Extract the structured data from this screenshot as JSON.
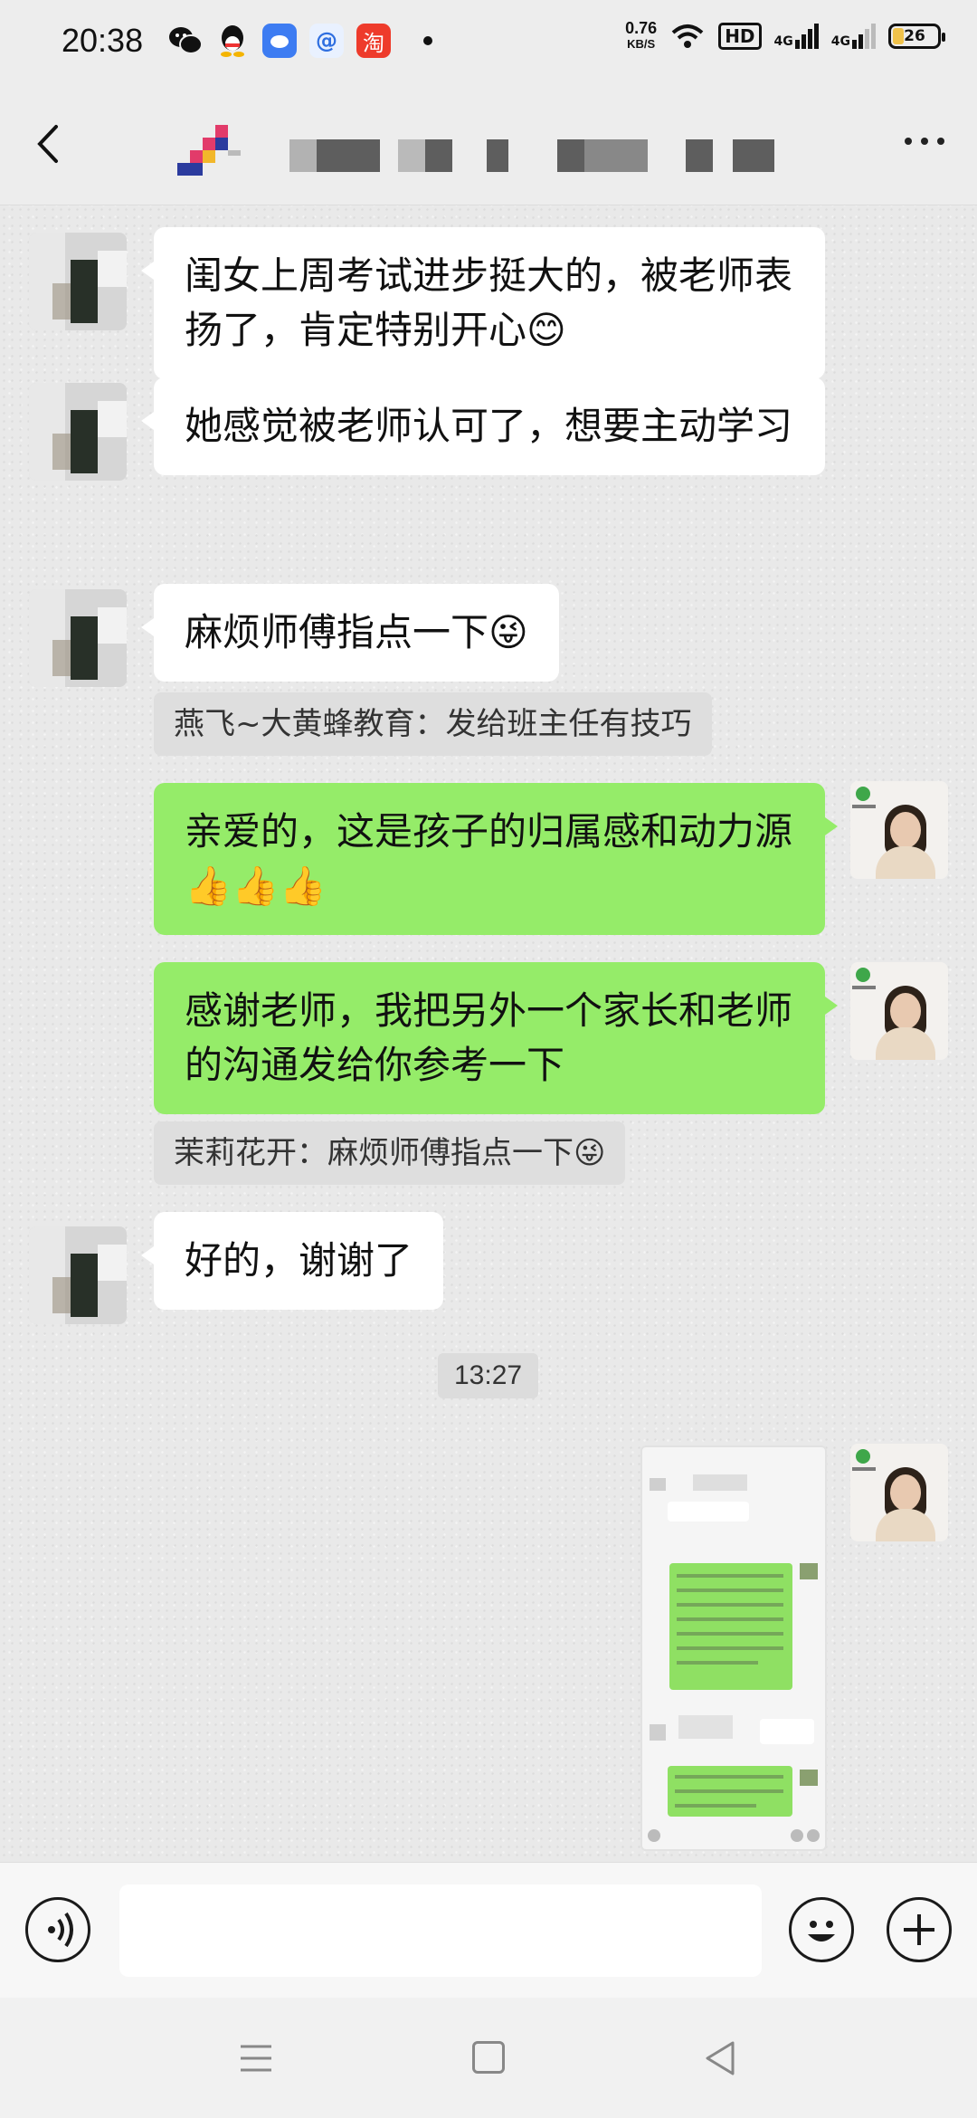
{
  "status_bar": {
    "time": "20:38",
    "speed_value": "0.76",
    "speed_unit": "KB/S",
    "hd_label": "HD",
    "signal1": "4G",
    "signal2": "4G",
    "battery": "26",
    "battery_level": 0.26,
    "app_icons": [
      "wechat-icon",
      "qq-icon",
      "cloud-icon",
      "at-icon",
      "taobao-icon"
    ]
  },
  "header": {
    "title_pixelated": true
  },
  "messages": [
    {
      "side": "left",
      "text": "闺女上周考试进步挺大的，被老师表扬了，肯定特别开心😊"
    },
    {
      "side": "left",
      "text": "她感觉被老师认可了，想要主动学习"
    },
    {
      "side": "left",
      "text": "麻烦师傅指点一下😜"
    },
    {
      "type": "quote",
      "text": "燕飞~大黄蜂教育：发给班主任有技巧"
    },
    {
      "side": "right",
      "text": "亲爱的，这是孩子的归属感和动力源👍👍👍"
    },
    {
      "side": "right",
      "text": "感谢老师，我把另外一个家长和老师的沟通发给你参考一下"
    },
    {
      "type": "quote",
      "text": "茉莉花开：麻烦师傅指点一下😜"
    },
    {
      "side": "left",
      "text": "好的，谢谢了"
    },
    {
      "type": "time",
      "text": "13:27"
    },
    {
      "side": "right",
      "type": "image",
      "icon": "screenshot-image"
    }
  ],
  "input_bar": {
    "value": "",
    "icons": [
      "voice-icon",
      "emoji-icon",
      "plus-icon"
    ]
  },
  "colors": {
    "bubble_right": "#95ec69",
    "bubble_left": "#ffffff",
    "chat_bg": "#e9e9e9"
  }
}
